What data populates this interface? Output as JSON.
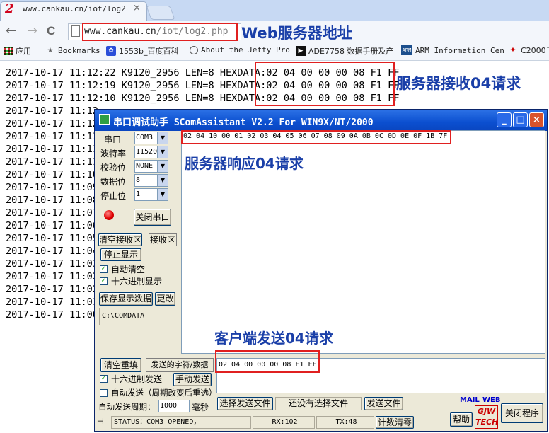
{
  "browser": {
    "tab_logo": "2",
    "tab_title": "www.cankau.cn/iot/log2",
    "tab_close": "×",
    "back": "←",
    "forward": "→",
    "reload": "C",
    "address_host": "www.cankau.cn",
    "address_path": "/iot/log2.php",
    "bookmarks": [
      {
        "icon": "apps-grid-icon",
        "label": "应用"
      },
      {
        "icon": "star-icon",
        "label": "Bookmarks"
      },
      {
        "icon": "baidu-paw-icon",
        "label": "1553b_百度百科"
      },
      {
        "icon": "globe-icon",
        "label": "About the Jetty Pro"
      },
      {
        "icon": "play-icon",
        "label": "ADE7758 数据手册及产"
      },
      {
        "icon": "arm-logo-icon",
        "label": "ARM Information Cen"
      },
      {
        "icon": "ti-logo-icon",
        "label": "C2000™"
      }
    ]
  },
  "annotations": {
    "web_address": "Web服务器地址",
    "server_receive": "服务器接收04请求",
    "server_response": "服务器响应04请求",
    "client_send": "客户端发送04请求"
  },
  "log_lines": [
    {
      "text": "2017-10-17 11:12:22 K9120_2956 LEN=8 HEXDATA:02 04 00 00 00 08 F1 FF"
    },
    {
      "text": "2017-10-17 11:12:19 K9120_2956 LEN=8 HEXDATA:02 04 00 00 00 08 F1 FF"
    },
    {
      "text": "2017-10-17 11:12:10 K9120_2956 LEN=8 HEXDATA:02 04 00 00 00 08 F1 FF"
    },
    {
      "text": "2017-10-17 11:12"
    },
    {
      "text": "2017-10-17 11:12"
    },
    {
      "text": "2017-10-17 11:11"
    },
    {
      "text": "2017-10-17 11:11"
    },
    {
      "text": "2017-10-17 11:11"
    },
    {
      "text": "2017-10-17 11:10"
    },
    {
      "text": "2017-10-17 11:09"
    },
    {
      "text": "2017-10-17 11:08"
    },
    {
      "text": "2017-10-17 11:07"
    },
    {
      "text": "2017-10-17 11:06"
    },
    {
      "text": "2017-10-17 11:05"
    },
    {
      "text": "2017-10-17 11:04"
    },
    {
      "text": "2017-10-17 11:03"
    },
    {
      "text": "2017-10-17 11:02"
    },
    {
      "text": "2017-10-17 11:02"
    },
    {
      "text": "2017-10-17 11:01"
    },
    {
      "text": "2017-10-17 11:00"
    }
  ],
  "dialog": {
    "title": "串口调试助手  SComAssistant V2.2 For WIN9X/NT/2000",
    "minimize": "_",
    "maximize": "□",
    "close": "×",
    "port_label": "串口",
    "port_value": "COM3",
    "baud_label": "波特率",
    "baud_value": "11520",
    "parity_label": "校验位",
    "parity_value": "NONE",
    "databits_label": "数据位",
    "databits_value": "8",
    "stopbits_label": "停止位",
    "stopbits_value": "1",
    "close_port": "关闭串口",
    "clear_recv": "清空接收区",
    "recv_area": "接收区",
    "stop_display": "停止显示",
    "auto_clear": "自动清空",
    "hex_display": "十六进制显示",
    "save_display": "保存显示数据",
    "change": "更改",
    "path": "C:\\COMDATA",
    "recv_hex": "02 04 10 00 01 02 03 04 05 06 07 08 09 0A 0B 0C 0D 0E 0F 1B 7F",
    "clear_resend": "清空重填",
    "send_chars_label": "发送的字符/数据",
    "send_hex_value": "02 04 00 00 00 08 F1 FF",
    "hex_send": "十六进制发送",
    "manual_send": "手动发送",
    "auto_send": "自动发送（周期改变后重选）",
    "auto_period_label": "自动发送周期：",
    "auto_period_value": "1000",
    "ms": "毫秒",
    "select_file": "选择发送文件",
    "no_file": "还没有选择文件",
    "send_file": "发送文件",
    "mail": "MAIL",
    "web": "WEB",
    "help": "帮助",
    "exit": "关闭程序",
    "logo_line1": "GJW",
    "logo_line2": "TECH",
    "status_text": "STATUS：COM3 OPENED，",
    "rx": "RX:102",
    "tx": "TX:48",
    "count_reset": "计数清零",
    "check_mark": "✓"
  }
}
